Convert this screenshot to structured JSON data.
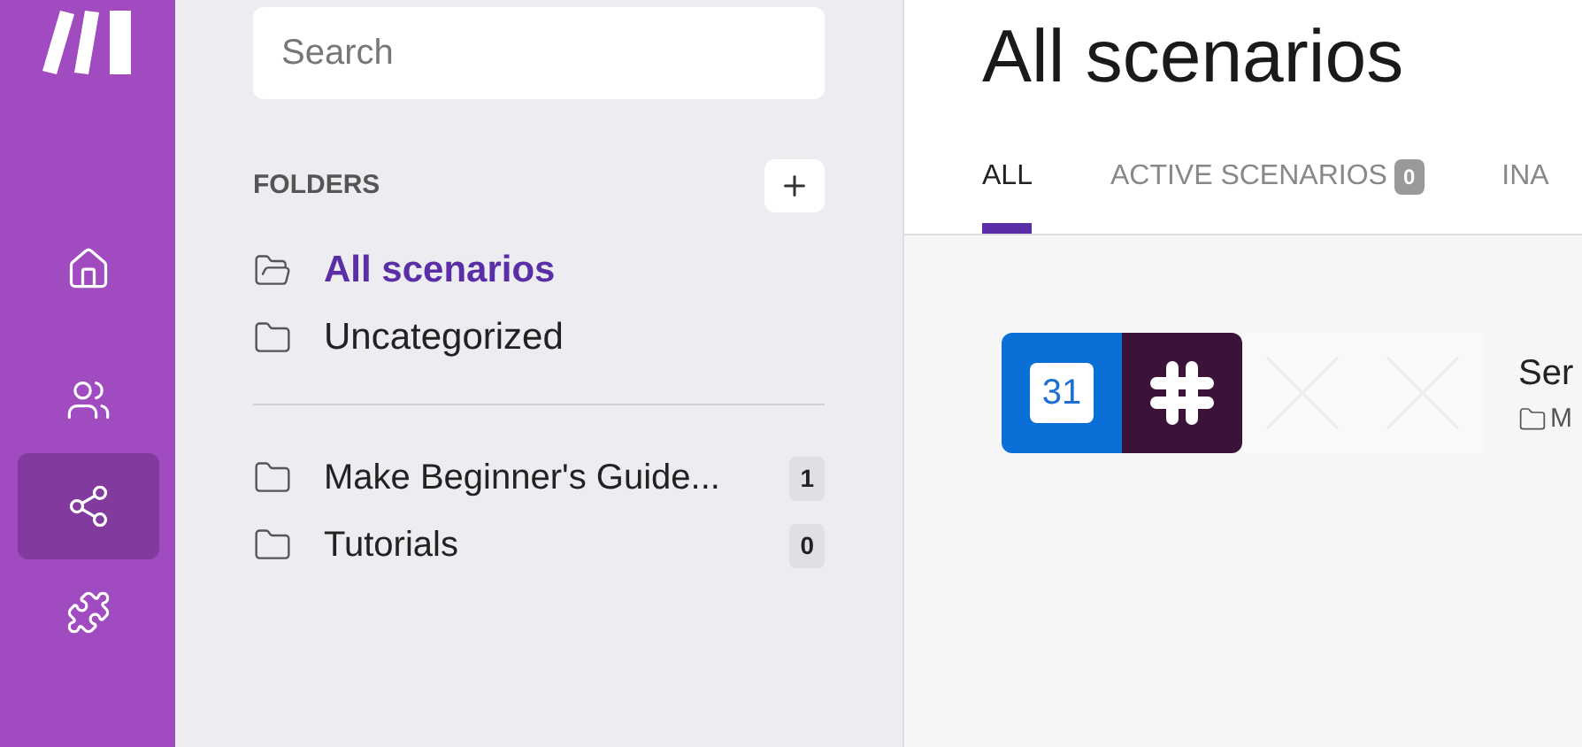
{
  "nav": [
    {
      "kind": "home",
      "selected": false
    },
    {
      "kind": "team",
      "selected": false
    },
    {
      "kind": "scenarios",
      "selected": true
    },
    {
      "kind": "apps",
      "selected": false
    }
  ],
  "search": {
    "placeholder": "Search"
  },
  "folders": {
    "title": "FOLDERS",
    "items": [
      {
        "label": "All scenarios",
        "selected": true,
        "open": true
      },
      {
        "label": "Uncategorized",
        "selected": false,
        "open": false
      }
    ],
    "custom": [
      {
        "label": "Make Beginner's Guide...",
        "count": "1",
        "selected": false
      },
      {
        "label": "Tutorials",
        "count": "0",
        "selected": false
      }
    ]
  },
  "page_title": "All scenarios",
  "tabs": [
    {
      "label": "ALL",
      "selected": true
    },
    {
      "label": "ACTIVE SCENARIOS",
      "count": "0",
      "selected": false
    },
    {
      "label": "INA",
      "selected": false
    }
  ],
  "scenario": {
    "name": "Ser",
    "folder": "M",
    "apps": [
      {
        "kind": "calendar",
        "label": "31"
      },
      {
        "kind": "slack"
      },
      {
        "kind": "empty"
      },
      {
        "kind": "empty"
      }
    ]
  }
}
